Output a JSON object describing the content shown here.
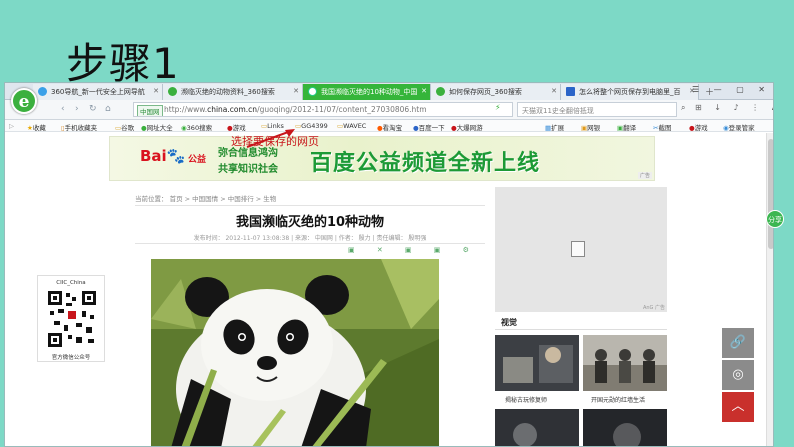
{
  "slide": {
    "title": "步骤1"
  },
  "tabs": [
    {
      "label": "360导航_新一代安全上网导航",
      "icon": "#3aa0e8",
      "active": false
    },
    {
      "label": "濒临灭绝的动物资料_360搜索",
      "icon": "#3bb03e",
      "active": false
    },
    {
      "label": "我国濒临灭绝的10种动物_中国",
      "icon": "#ffffff",
      "active": true
    },
    {
      "label": "如何保存网页_360搜索",
      "icon": "#3bb03e",
      "active": false
    },
    {
      "label": "怎么将整个网页保存到电脑里_百",
      "icon": "#2b64c8",
      "active": false
    }
  ],
  "window_controls": "☰ — ▢ ✕",
  "address": {
    "zone_label": "中国网",
    "url_prefix": "http://www.",
    "url_domain": "china.com.cn",
    "url_path": "/guoqing/2012-11/07/content_27030806.htm",
    "search_text": "天猫双11史全翻倍抵现"
  },
  "toolbar_right": "⊞ ↓ ♪ ⋮ ⤢ ≡",
  "bookmarks_left": [
    {
      "label": "收藏",
      "icon": "star-icon"
    },
    {
      "label": "手机收藏夹",
      "icon": "phone-icon"
    },
    {
      "label": "谷歌",
      "icon": "folder-icon"
    },
    {
      "label": "网址大全",
      "icon": "globe-icon"
    },
    {
      "label": "360搜索",
      "icon": "search-icon"
    },
    {
      "label": "游戏",
      "icon": "game-icon"
    },
    {
      "label": "Links",
      "icon": "folder-icon"
    },
    {
      "label": "GG4399",
      "icon": "folder-icon"
    },
    {
      "label": "WAVEC",
      "icon": "folder-icon"
    },
    {
      "label": "看淘宝",
      "icon": "taobao-icon"
    },
    {
      "label": "百度一下",
      "icon": "baidu-icon"
    },
    {
      "label": "大爆网游",
      "icon": "game-icon"
    }
  ],
  "bookmarks_right": [
    {
      "label": "扩展",
      "icon": "grid-icon"
    },
    {
      "label": "网银",
      "icon": "card-icon"
    },
    {
      "label": "翻译",
      "icon": "translate-icon"
    },
    {
      "label": "截图",
      "icon": "scissors-icon"
    },
    {
      "label": "游戏",
      "icon": "game-icon"
    },
    {
      "label": "登录管家",
      "icon": "user-icon"
    }
  ],
  "annotation": "选择要保存的网页",
  "banner": {
    "logo_bai": "Bai",
    "logo_du": "度",
    "logo_pub": "公益",
    "slogan1": "弥合信息鸿沟",
    "slogan2": "共享知识社会",
    "headline": "百度公益频道全新上线",
    "ad_tag": "广告"
  },
  "article": {
    "breadcrumb": "当前位置： 首页 > 中国国情 > 中国排行 > 生物",
    "title": "我国濒临灭绝的10种动物",
    "meta": "发布时间： 2012-11-07 13:08:38  |  来源： 中国网  |  作者： 殷力  |  责任编辑： 殷明强"
  },
  "share_icons": "▣ ✕ ▣ ▣ ⚙",
  "qr": {
    "title": "CIIC_China",
    "caption": "官方微信公众号"
  },
  "ad_box": {
    "label": "AnG 广告"
  },
  "sidebar": {
    "section_title": "视觉",
    "captions": [
      "揭秘古玩修复师",
      "开国元勋的红墙生活"
    ]
  },
  "float_badge": "分享",
  "side_buttons": [
    "share-link",
    "weibo",
    "back-to-top"
  ]
}
